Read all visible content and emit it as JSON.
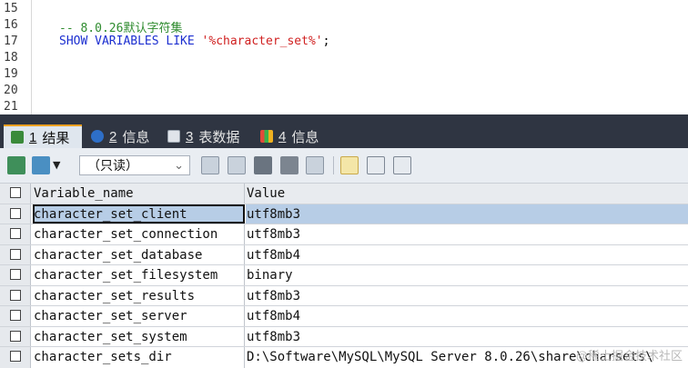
{
  "editor": {
    "lines": [
      {
        "no": "15",
        "text": ""
      },
      {
        "no": "16",
        "text": "-- 8.0.26默认字符集"
      },
      {
        "no": "17",
        "kw": "SHOW VARIABLES LIKE ",
        "str": "'%character_set%'",
        "tail": ";"
      },
      {
        "no": "18",
        "text": ""
      },
      {
        "no": "19",
        "text": ""
      },
      {
        "no": "20",
        "text": ""
      },
      {
        "no": "21",
        "text": ""
      }
    ]
  },
  "tabs": [
    {
      "num": "1",
      "label": "结果",
      "icon": "result-grid-icon",
      "active": true
    },
    {
      "num": "2",
      "label": "信息",
      "icon": "info-icon",
      "active": false
    },
    {
      "num": "3",
      "label": "表数据",
      "icon": "table-data-icon",
      "active": false
    },
    {
      "num": "4",
      "label": "信息",
      "icon": "info-colored-icon",
      "active": false
    }
  ],
  "toolbar": {
    "mode_select": "（只读）"
  },
  "grid": {
    "headers": [
      "Variable_name",
      "Value"
    ],
    "rows": [
      [
        "character_set_client",
        "utf8mb3"
      ],
      [
        "character_set_connection",
        "utf8mb3"
      ],
      [
        "character_set_database",
        "utf8mb4"
      ],
      [
        "character_set_filesystem",
        "binary"
      ],
      [
        "character_set_results",
        "utf8mb3"
      ],
      [
        "character_set_server",
        "utf8mb4"
      ],
      [
        "character_set_system",
        "utf8mb3"
      ],
      [
        "character_sets_dir",
        "D:\\Software\\MySQL\\MySQL Server 8.0.26\\share\\charsets\\"
      ]
    ]
  },
  "watermark": "@稀土掘金技术社区",
  "colors": {
    "accent_tab": "#f0a020",
    "selection": "#b7cde6",
    "dark_bar": "#2f3542"
  }
}
